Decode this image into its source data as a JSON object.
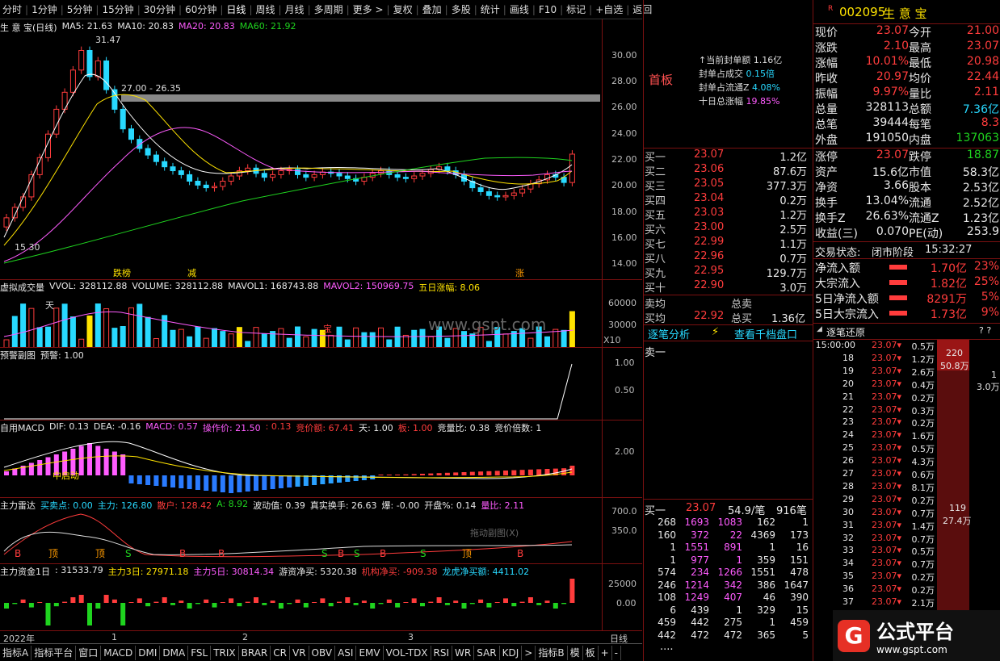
{
  "toolbar": {
    "items": [
      "分时",
      "1分钟",
      "5分钟",
      "15分钟",
      "30分钟",
      "60分钟",
      "日线",
      "周线",
      "月线",
      "多周期",
      "更多 >"
    ],
    "right_items": [
      "复权",
      "叠加",
      "多股",
      "统计",
      "画线",
      "F10",
      "标记",
      "+自选",
      "返回"
    ]
  },
  "kline": {
    "title": "生 意 宝(日线)",
    "ma5": "MA5: 21.63",
    "ma10": "MA10: 20.83",
    "ma20": "MA20: 20.83",
    "ma60": "MA60: 21.92",
    "high_label": "31.47",
    "low_label": "15.30",
    "range_label": "27.00 - 26.35",
    "tags": [
      "跌榜",
      "减",
      "涨"
    ],
    "yticks": [
      "30.00",
      "28.00",
      "26.00",
      "24.00",
      "22.00",
      "20.00",
      "18.00",
      "16.00",
      "14.00"
    ]
  },
  "vol": {
    "title": "虚拟成交量",
    "vvol": "VVOL: 328112.88",
    "volume": "VOLUME: 328112.88",
    "mavol1": "MAVOL1: 168743.88",
    "mavol2": "MAVOL2: 150969.75",
    "five_day": "五日涨幅: 8.06",
    "yticks": [
      "60000",
      "30000"
    ],
    "x10": "X10",
    "watermark": "www.gspt.com",
    "tag_tian": "天",
    "tag_bao": "宝"
  },
  "warn": {
    "title": "预警副图",
    "value": "预警: 1.00",
    "yticks": [
      "1.00",
      "0.50"
    ]
  },
  "macd": {
    "title": "自用MACD",
    "dif": "DIF: 0.13",
    "dea": "DEA: -0.16",
    "macd": "MACD: 0.57",
    "op": "操作价: 21.50",
    "v1": ": 0.13",
    "jingjia": "竞价额: 67.41",
    "tian": "天: 1.00",
    "ban": "板: 1.00",
    "liangbi": "竞量比: 0.38",
    "beishu": "竞价倍数: 1",
    "ytick": "2.00",
    "label": "中启动"
  },
  "radar": {
    "title": "主力雷达",
    "maimai": "买卖点: 0.00",
    "zhuli": "主力: 126.80",
    "sanhu": "散户: 128.42",
    "a": "A: 8.92",
    "bodong": "波动值: 0.39",
    "huanshou": "真实换手: 26.63",
    "bao": "爆: -0.00",
    "kaipan": "开盘%: 0.14",
    "liangbi": "量比: 2.11",
    "yticks": [
      "700.0",
      "350.0"
    ],
    "hint": "拖动副图(X)",
    "markers": [
      "B",
      "顶",
      "顶",
      "S",
      "B",
      "B",
      "S",
      "B",
      "S",
      "B",
      "S",
      "顶",
      "B"
    ]
  },
  "fund": {
    "title": "主力资金1日",
    "v": ": 31533.79",
    "d3": "主力3日: 27971.18",
    "d5": "主力5日: 30814.34",
    "youzi": "游资净买: 5320.38",
    "jigou": "机构净买: -909.38",
    "longhu": "龙虎净买额: 4411.02",
    "yticks": [
      "25000",
      "0.00"
    ]
  },
  "dates": [
    "2022年",
    "1",
    "2",
    "3"
  ],
  "date_tail": "日线",
  "bottombar": [
    "指标A",
    "指标平台",
    "窗口",
    "MACD",
    "DMI",
    "DMA",
    "FSL",
    "TRIX",
    "BRAR",
    "CR",
    "VR",
    "OBV",
    "ASI",
    "EMV",
    "VOL-TDX",
    "RSI",
    "WR",
    "SAR",
    "KDJ",
    ">",
    "指标B",
    "模",
    "板",
    "+",
    "-"
  ],
  "mid": {
    "shouban": "首板",
    "seal": [
      [
        "当前封单额",
        "1.16亿"
      ],
      [
        "封单占成交",
        "0.15倍"
      ],
      [
        "封单占流通Z",
        "4.08%"
      ],
      [
        "十日总涨幅",
        "19.85%"
      ]
    ],
    "bids": [
      [
        "买一",
        "23.07",
        "1.2亿"
      ],
      [
        "买二",
        "23.06",
        "87.6万"
      ],
      [
        "买三",
        "23.05",
        "377.3万"
      ],
      [
        "买四",
        "23.04",
        "0.2万"
      ],
      [
        "买五",
        "23.03",
        "1.2万"
      ],
      [
        "买六",
        "23.00",
        "2.5万"
      ],
      [
        "买七",
        "22.99",
        "1.1万"
      ],
      [
        "买八",
        "22.96",
        "0.7万"
      ],
      [
        "买九",
        "22.95",
        "129.7万"
      ],
      [
        "买十",
        "22.90",
        "3.0万"
      ]
    ],
    "maijun": "卖均",
    "zongmai": "总卖",
    "buyjun": "买均",
    "buyjun_v": "22.92",
    "zongbuy": "总买",
    "zongbuy_v": "1.36亿",
    "tab1": "逐笔分析",
    "tab2": "查看千档盘口",
    "sell1": "卖一",
    "buy1_label": "买一",
    "buy1_price": "23.07",
    "buy1_avg": "54.9/笔",
    "buy1_cnt": "916笔",
    "queue": [
      [
        "268",
        "1693",
        "1083",
        "162",
        "1"
      ],
      [
        "160",
        "372",
        "22",
        "4369",
        "173"
      ],
      [
        "1",
        "1551",
        "891",
        "1",
        "16"
      ],
      [
        "1",
        "977",
        "1",
        "359",
        "151"
      ],
      [
        "574",
        "234",
        "1266",
        "1551",
        "478"
      ],
      [
        "246",
        "1214",
        "342",
        "386",
        "1647"
      ],
      [
        "108",
        "1249",
        "407",
        "46",
        "390"
      ],
      [
        "6",
        "439",
        "1",
        "329",
        "15"
      ],
      [
        "459",
        "442",
        "275",
        "1",
        "459"
      ],
      [
        "442",
        "472",
        "472",
        "365",
        "5"
      ]
    ],
    "dots": "...."
  },
  "right": {
    "code": "002095",
    "name": "生 意 宝",
    "r": "R",
    "quote": [
      [
        "现价",
        "23.07",
        "今开",
        "21.00"
      ],
      [
        "涨跌",
        "2.10",
        "最高",
        "23.07"
      ],
      [
        "涨幅",
        "10.01%",
        "最低",
        "20.98"
      ],
      [
        "昨收",
        "20.97",
        "均价",
        "22.44"
      ],
      [
        "振幅",
        "9.97%",
        "量比",
        "2.11"
      ],
      [
        "总量",
        "328113",
        "总额",
        "7.36亿"
      ],
      [
        "总笔",
        "39444",
        "每笔",
        "8.3"
      ],
      [
        "外盘",
        "191050",
        "内盘",
        "137063"
      ]
    ],
    "stats": [
      [
        "涨停",
        "23.07",
        "跌停",
        "18.87"
      ],
      [
        "资产",
        "15.6亿",
        "市值",
        "58.3亿"
      ],
      [
        "净资",
        "3.66",
        "股本",
        "2.53亿"
      ],
      [
        "换手",
        "13.04%",
        "流通",
        "2.52亿"
      ],
      [
        "换手Z",
        "26.63%",
        "流通Z",
        "1.23亿"
      ],
      [
        "收益(三)",
        "0.070",
        "PE(动)",
        "253.9"
      ]
    ],
    "status_label": "交易状态:",
    "status": "闭市阶段",
    "time": "15:32:27",
    "flows": [
      [
        "净流入额",
        "1.70亿",
        "23%"
      ],
      [
        "大宗流入",
        "1.82亿",
        "25%"
      ],
      [
        "5日净流入额",
        "8291万",
        "5%"
      ],
      [
        "5日大宗流入",
        "1.73亿",
        "9%"
      ]
    ],
    "trace_title": "逐笔还原",
    "trace_q": "? ?",
    "trace": [
      [
        "15:00:00",
        "23.07",
        "0.5万"
      ],
      [
        "18",
        "23.07",
        "1.2万"
      ],
      [
        "19",
        "23.07",
        "2.6万"
      ],
      [
        "20",
        "23.07",
        "0.4万"
      ],
      [
        "21",
        "23.07",
        "0.2万"
      ],
      [
        "22",
        "23.07",
        "0.3万"
      ],
      [
        "23",
        "23.07",
        "0.2万"
      ],
      [
        "24",
        "23.07",
        "1.6万"
      ],
      [
        "25",
        "23.07",
        "0.5万"
      ],
      [
        "26",
        "23.07",
        "4.3万"
      ],
      [
        "27",
        "23.07",
        "0.6万"
      ],
      [
        "28",
        "23.07",
        "8.1万"
      ],
      [
        "29",
        "23.07",
        "0.2万"
      ],
      [
        "30",
        "23.07",
        "0.7万"
      ],
      [
        "31",
        "23.07",
        "1.4万"
      ],
      [
        "32",
        "23.07",
        "0.7万"
      ],
      [
        "33",
        "23.07",
        "0.5万"
      ],
      [
        "34",
        "23.07",
        "0.7万"
      ],
      [
        "35",
        "23.07",
        "0.2万"
      ],
      [
        "36",
        "23.07",
        "0.2万"
      ],
      [
        "37",
        "23.07",
        "2.1万"
      ]
    ],
    "bar1_a": "220",
    "bar1_b": "50.8万",
    "bar1_c": "1",
    "bar1_d": "3.0万",
    "bar2_a": "119",
    "bar2_b": "27.4万",
    "logo": "公式平台",
    "logo_url": "www.gspt.com"
  },
  "colors": {
    "up": "#ff3c3c",
    "down": "#28d9ff",
    "grid": "#7a1010",
    "yellow": "#ffe300"
  }
}
